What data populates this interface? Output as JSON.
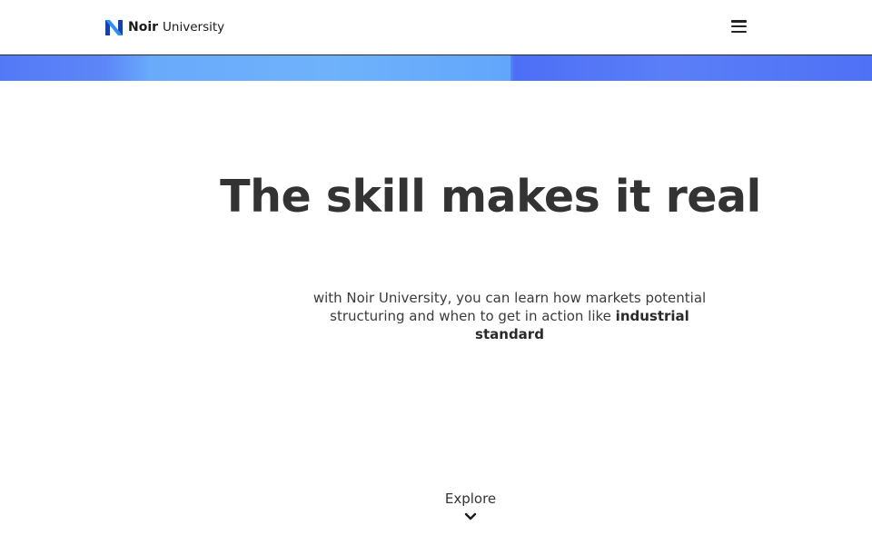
{
  "nav": {
    "brand_name": "Noir",
    "brand_sub": "University",
    "menu_icon": "hamburger-menu-icon",
    "logo_icon": "noir-n-logo-icon"
  },
  "hero": {
    "title": "The skill makes it real",
    "text_before": "with Noir University, you can learn how markets potential structuring and when to get in action like ",
    "text_bold": "industrial standard",
    "explore_label": "Explore",
    "explore_icon": "chevron-down-icon"
  },
  "colors": {
    "banner_blue": "#5479f7",
    "banner_light_blue": "#6fb0fc",
    "text_dark": "#333333",
    "logo_blue": "#1e6fe0"
  }
}
